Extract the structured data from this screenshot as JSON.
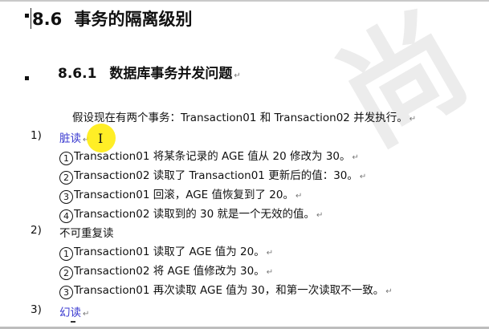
{
  "section": {
    "number": "8.6",
    "title": "事务的隔离级别"
  },
  "subsection": {
    "number": "8.6.1",
    "title": "数据库事务并发问题"
  },
  "intro": "假设现在有两个事务：Transaction01 和 Transaction02 并发执行。",
  "paragraph_mark": "↵",
  "items": [
    {
      "num": "1)",
      "heading": "脏读",
      "lines": [
        {
          "circle": "1",
          "text": "Transaction01 将某条记录的 AGE 值从 20 修改为 30。"
        },
        {
          "circle": "2",
          "text": "Transaction02 读取了 Transaction01 更新后的值：30。"
        },
        {
          "circle": "3",
          "text": "Transaction01 回滚，AGE 值恢复到了 20。"
        },
        {
          "circle": "4",
          "text": "Transaction02 读取到的 30 就是一个无效的值。"
        }
      ]
    },
    {
      "num": "2)",
      "heading": "不可重复读",
      "lines": [
        {
          "circle": "1",
          "text": "Transaction01 读取了 AGE 值为 20。"
        },
        {
          "circle": "2",
          "text": "Transaction02 将 AGE 值修改为 30。"
        },
        {
          "circle": "3",
          "text": "Transaction01 再次读取 AGE 值为 30，和第一次读取不一致。"
        }
      ]
    },
    {
      "num": "3)",
      "heading": "幻读",
      "lines": []
    }
  ],
  "colors": {
    "link": "#3a3ad0",
    "highlight": "#ffeb00",
    "text": "#111111"
  }
}
